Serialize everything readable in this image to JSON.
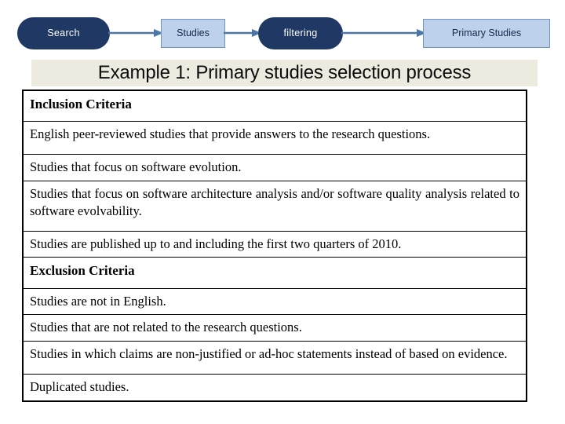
{
  "flow": {
    "nodes": [
      {
        "id": "search",
        "label": "Search",
        "shape": "pill",
        "fill": "#1F3864",
        "text_color": "#FFFFFF"
      },
      {
        "id": "studies",
        "label": "Studies",
        "shape": "rect",
        "fill": "#BDD2EA",
        "text_color": "#13274A"
      },
      {
        "id": "filter",
        "label": "filtering",
        "shape": "pill",
        "fill": "#1F3864",
        "text_color": "#FFFFFF"
      },
      {
        "id": "primary",
        "label": "Primary Studies",
        "shape": "rect",
        "fill": "#BDD2EA",
        "text_color": "#13274A"
      }
    ],
    "connector_color": "#4A76A8",
    "connector_icons": [
      "arrow-right-icon",
      "arrow-right-icon",
      "arrow-right-icon"
    ]
  },
  "title": {
    "text": "Example 1: Primary studies selection process",
    "band_color": "#EDEAE0"
  },
  "table": {
    "border_color": "#000000",
    "rows": [
      {
        "type": "header",
        "text": "Inclusion Criteria"
      },
      {
        "type": "item",
        "text": "English peer-reviewed studies that provide answers to the research questions."
      },
      {
        "type": "item",
        "text": "Studies that focus on software evolution."
      },
      {
        "type": "item",
        "text": "Studies that focus on software architecture analysis and/or software quality analysis related to software evolvability."
      },
      {
        "type": "item",
        "text": "Studies are published up to and including the first two quarters of 2010."
      },
      {
        "type": "header",
        "text": "Exclusion Criteria"
      },
      {
        "type": "item",
        "text": "Studies are not in English."
      },
      {
        "type": "item",
        "text": "Studies that are not related to the research questions."
      },
      {
        "type": "item",
        "text": "Studies in which claims are non-justified or ad-hoc statements instead of based on evidence."
      },
      {
        "type": "item",
        "text": "Duplicated studies."
      }
    ]
  }
}
